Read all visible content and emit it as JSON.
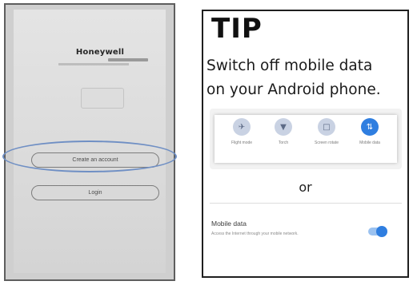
{
  "phone": {
    "brand": "Honeywell",
    "create_account_label": "Create an account",
    "login_label": "Login"
  },
  "tip": {
    "title": "TIP",
    "line1": "Switch off mobile data",
    "line2": "on your Android phone.",
    "quick_settings": [
      {
        "label": "Flight mode",
        "icon": "airplane-icon",
        "active": false
      },
      {
        "label": "Torch",
        "icon": "flashlight-icon",
        "active": false
      },
      {
        "label": "Screen rotate",
        "icon": "rotate-icon",
        "active": false
      },
      {
        "label": "Mobile data",
        "icon": "mobile-data-icon",
        "active": true
      }
    ],
    "or": "or",
    "mobile_data": {
      "title": "Mobile data",
      "description": "Access the Internet through your mobile network.",
      "enabled": true
    },
    "accent_color": "#2f7ee0",
    "highlight_color": "#6f8fc4"
  }
}
